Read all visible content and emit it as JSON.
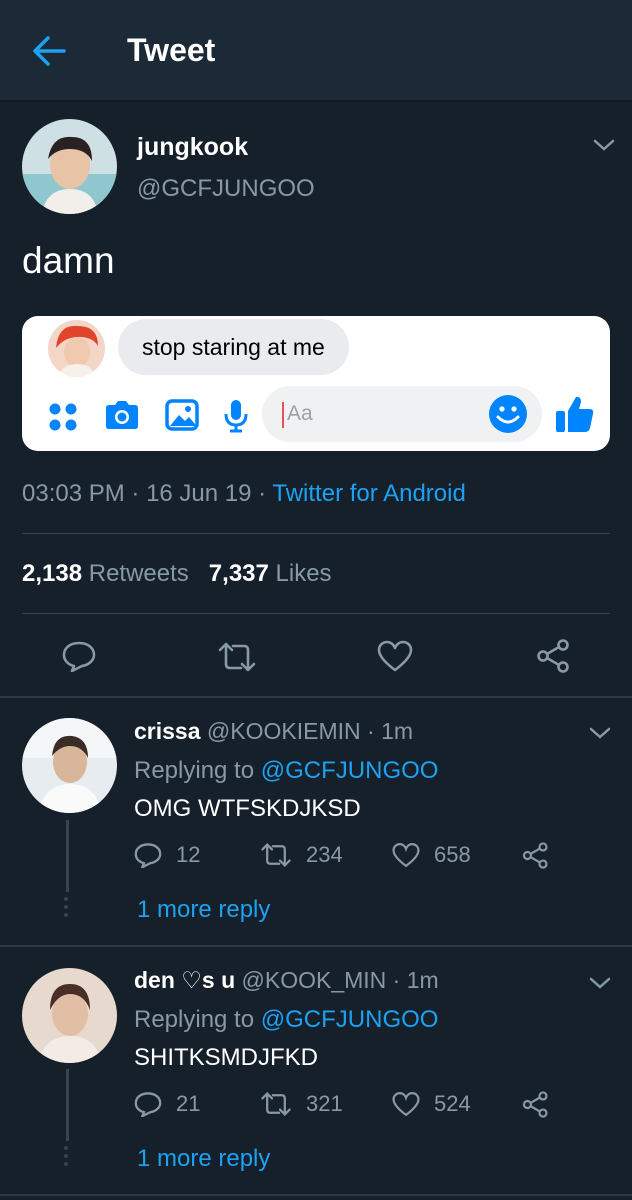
{
  "header": {
    "title": "Tweet",
    "back_icon": "arrow-left-icon"
  },
  "tweet": {
    "author_name": "jungkook",
    "author_handle": "@GCFJUNGOO",
    "text": "damn",
    "card": {
      "message": "stop staring at me",
      "input_placeholder": "Aa",
      "icons": [
        "apps-icon",
        "camera-icon",
        "image-icon",
        "microphone-icon",
        "emoji-icon",
        "thumbs-up-icon"
      ],
      "accent": "#0084ff"
    },
    "time": "03:03 PM",
    "date": "16 Jun 19",
    "source": "Twitter for Android",
    "retweets_count": "2,138",
    "retweets_label": "Retweets",
    "likes_count": "7,337",
    "likes_label": "Likes"
  },
  "replies": [
    {
      "name": "crissa",
      "handle": "@KOOKIEMIN",
      "time": "1m",
      "replying_label": "Replying to",
      "replying_to": "@GCFJUNGOO",
      "text": "OMG WTFSKDJKSD",
      "reply_count": "12",
      "retweet_count": "234",
      "like_count": "658",
      "more": "1 more reply"
    },
    {
      "name": "den ♡s u",
      "handle": "@KOOK_MIN",
      "time": "1m",
      "replying_label": "Replying to",
      "replying_to": "@GCFJUNGOO",
      "text": "SHITKSMDJFKD",
      "reply_count": "21",
      "retweet_count": "321",
      "like_count": "524",
      "more": "1 more reply"
    }
  ],
  "colors": {
    "background": "#15202b",
    "header": "#1c2937",
    "link": "#1da1f2",
    "muted": "#8899a6"
  }
}
